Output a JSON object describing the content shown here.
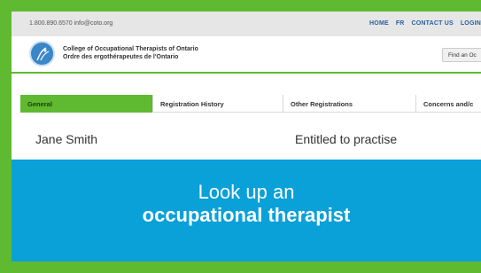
{
  "topbar": {
    "contact": "1.800.890.6570  info@coto.org",
    "nav": [
      "HOME",
      "FR",
      "CONTACT US",
      "LOGIN"
    ]
  },
  "brand": {
    "org_en": "College of Occupational Therapists of Ontario",
    "org_fr": "Ordre des ergothérapeutes de l'Ontario",
    "find_button": "Find an Oc"
  },
  "tabs": [
    {
      "label": "General",
      "active": true
    },
    {
      "label": "Registration History",
      "active": false
    },
    {
      "label": "Other Registrations",
      "active": false
    },
    {
      "label": "Concerns and/c",
      "active": false
    }
  ],
  "record": {
    "name": "Jane Smith",
    "status": "Entitled to practise"
  },
  "banner": {
    "line1": "Look up an",
    "line2": "occupational therapist"
  },
  "colors": {
    "accent_green": "#5fba31",
    "banner_blue": "#0aa0d8",
    "nav_blue": "#2a5fa0"
  }
}
